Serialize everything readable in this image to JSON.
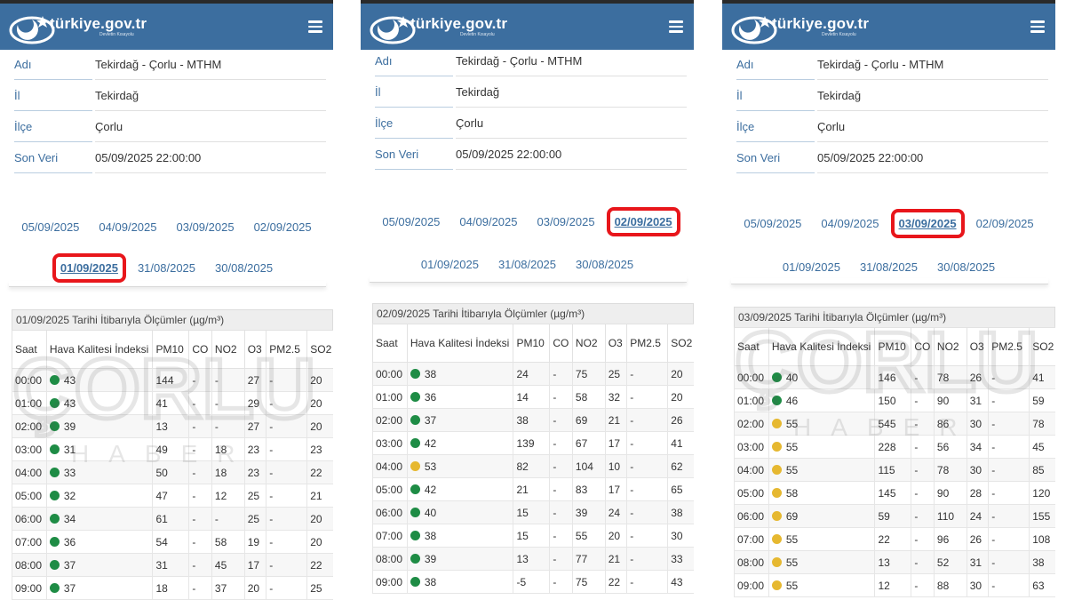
{
  "brand": {
    "name": "türkiye.gov.tr",
    "tagline": "Devletin Kısayolu"
  },
  "watermark": {
    "name": "ÇORLU",
    "sub": "HABER"
  },
  "colors": {
    "good": "#1e8c45",
    "moderate": "#e6b830",
    "header": "#3c6e9f",
    "highlight": "#e8161b"
  },
  "station": {
    "labels": {
      "name": "Adı",
      "province": "İl",
      "district": "İlçe",
      "last": "Son Veri"
    },
    "name": "Tekirdağ - Çorlu - MTHM",
    "province": "Tekirdağ",
    "district": "Çorlu",
    "last": "05/09/2025 22:00:00"
  },
  "dates": [
    "05/09/2025",
    "04/09/2025",
    "03/09/2025",
    "02/09/2025",
    "01/09/2025",
    "31/08/2025",
    "30/08/2025"
  ],
  "columns": [
    "Saat",
    "Hava Kalitesi İndeksi",
    "PM10",
    "CO",
    "NO2",
    "O3",
    "PM2.5",
    "SO2"
  ],
  "panels": [
    {
      "selected_date": "01/09/2025",
      "caption": "01/09/2025 Tarihi İtibarıyla Ölçümler (µg/m³)",
      "rows": [
        {
          "time": "00:00",
          "aqi": "43",
          "level": "good",
          "pm10": "144",
          "co": "-",
          "no2": "-",
          "o3": "27",
          "pm25": "-",
          "so2": "20"
        },
        {
          "time": "01:00",
          "aqi": "43",
          "level": "good",
          "pm10": "41",
          "co": "-",
          "no2": "-",
          "o3": "29",
          "pm25": "-",
          "so2": "20"
        },
        {
          "time": "02:00",
          "aqi": "39",
          "level": "good",
          "pm10": "13",
          "co": "-",
          "no2": "-",
          "o3": "27",
          "pm25": "-",
          "so2": "20"
        },
        {
          "time": "03:00",
          "aqi": "31",
          "level": "good",
          "pm10": "49",
          "co": "-",
          "no2": "18",
          "o3": "23",
          "pm25": "-",
          "so2": "23"
        },
        {
          "time": "04:00",
          "aqi": "33",
          "level": "good",
          "pm10": "50",
          "co": "-",
          "no2": "18",
          "o3": "23",
          "pm25": "-",
          "so2": "22"
        },
        {
          "time": "05:00",
          "aqi": "32",
          "level": "good",
          "pm10": "47",
          "co": "-",
          "no2": "12",
          "o3": "25",
          "pm25": "-",
          "so2": "21"
        },
        {
          "time": "06:00",
          "aqi": "34",
          "level": "good",
          "pm10": "61",
          "co": "-",
          "no2": "-",
          "o3": "25",
          "pm25": "-",
          "so2": "20"
        },
        {
          "time": "07:00",
          "aqi": "36",
          "level": "good",
          "pm10": "54",
          "co": "-",
          "no2": "58",
          "o3": "19",
          "pm25": "-",
          "so2": "20"
        },
        {
          "time": "08:00",
          "aqi": "37",
          "level": "good",
          "pm10": "31",
          "co": "-",
          "no2": "45",
          "o3": "17",
          "pm25": "-",
          "so2": "22"
        },
        {
          "time": "09:00",
          "aqi": "37",
          "level": "good",
          "pm10": "18",
          "co": "-",
          "no2": "37",
          "o3": "20",
          "pm25": "-",
          "so2": "25"
        }
      ]
    },
    {
      "selected_date": "02/09/2025",
      "caption": "02/09/2025 Tarihi İtibarıyla Ölçümler (µg/m³)",
      "rows": [
        {
          "time": "00:00",
          "aqi": "38",
          "level": "good",
          "pm10": "24",
          "co": "-",
          "no2": "75",
          "o3": "25",
          "pm25": "-",
          "so2": "20"
        },
        {
          "time": "01:00",
          "aqi": "36",
          "level": "good",
          "pm10": "14",
          "co": "-",
          "no2": "58",
          "o3": "32",
          "pm25": "-",
          "so2": "20"
        },
        {
          "time": "02:00",
          "aqi": "37",
          "level": "good",
          "pm10": "38",
          "co": "-",
          "no2": "69",
          "o3": "21",
          "pm25": "-",
          "so2": "26"
        },
        {
          "time": "03:00",
          "aqi": "42",
          "level": "good",
          "pm10": "139",
          "co": "-",
          "no2": "67",
          "o3": "17",
          "pm25": "-",
          "so2": "41"
        },
        {
          "time": "04:00",
          "aqi": "53",
          "level": "moderate",
          "pm10": "82",
          "co": "-",
          "no2": "104",
          "o3": "10",
          "pm25": "-",
          "so2": "62"
        },
        {
          "time": "05:00",
          "aqi": "42",
          "level": "good",
          "pm10": "21",
          "co": "-",
          "no2": "83",
          "o3": "17",
          "pm25": "-",
          "so2": "65"
        },
        {
          "time": "06:00",
          "aqi": "40",
          "level": "good",
          "pm10": "15",
          "co": "-",
          "no2": "39",
          "o3": "24",
          "pm25": "-",
          "so2": "38"
        },
        {
          "time": "07:00",
          "aqi": "38",
          "level": "good",
          "pm10": "15",
          "co": "-",
          "no2": "55",
          "o3": "20",
          "pm25": "-",
          "so2": "30"
        },
        {
          "time": "08:00",
          "aqi": "39",
          "level": "good",
          "pm10": "13",
          "co": "-",
          "no2": "77",
          "o3": "21",
          "pm25": "-",
          "so2": "33"
        },
        {
          "time": "09:00",
          "aqi": "38",
          "level": "good",
          "pm10": "-5",
          "co": "-",
          "no2": "75",
          "o3": "22",
          "pm25": "-",
          "so2": "43"
        }
      ]
    },
    {
      "selected_date": "03/09/2025",
      "caption": "03/09/2025 Tarihi İtibarıyla Ölçümler (µg/m³)",
      "rows": [
        {
          "time": "00:00",
          "aqi": "40",
          "level": "good",
          "pm10": "146",
          "co": "-",
          "no2": "78",
          "o3": "26",
          "pm25": "-",
          "so2": "41"
        },
        {
          "time": "01:00",
          "aqi": "46",
          "level": "good",
          "pm10": "150",
          "co": "-",
          "no2": "90",
          "o3": "31",
          "pm25": "-",
          "so2": "59"
        },
        {
          "time": "02:00",
          "aqi": "55",
          "level": "moderate",
          "pm10": "545",
          "co": "-",
          "no2": "86",
          "o3": "30",
          "pm25": "-",
          "so2": "78"
        },
        {
          "time": "03:00",
          "aqi": "55",
          "level": "moderate",
          "pm10": "228",
          "co": "-",
          "no2": "56",
          "o3": "34",
          "pm25": "-",
          "so2": "45"
        },
        {
          "time": "04:00",
          "aqi": "55",
          "level": "moderate",
          "pm10": "115",
          "co": "-",
          "no2": "78",
          "o3": "30",
          "pm25": "-",
          "so2": "85"
        },
        {
          "time": "05:00",
          "aqi": "58",
          "level": "moderate",
          "pm10": "145",
          "co": "-",
          "no2": "90",
          "o3": "28",
          "pm25": "-",
          "so2": "120"
        },
        {
          "time": "06:00",
          "aqi": "69",
          "level": "moderate",
          "pm10": "59",
          "co": "-",
          "no2": "110",
          "o3": "24",
          "pm25": "-",
          "so2": "155"
        },
        {
          "time": "07:00",
          "aqi": "55",
          "level": "moderate",
          "pm10": "22",
          "co": "-",
          "no2": "96",
          "o3": "26",
          "pm25": "-",
          "so2": "108"
        },
        {
          "time": "08:00",
          "aqi": "55",
          "level": "moderate",
          "pm10": "13",
          "co": "-",
          "no2": "52",
          "o3": "31",
          "pm25": "-",
          "so2": "38"
        },
        {
          "time": "09:00",
          "aqi": "55",
          "level": "moderate",
          "pm10": "12",
          "co": "-",
          "no2": "88",
          "o3": "30",
          "pm25": "-",
          "so2": "63"
        }
      ]
    }
  ]
}
